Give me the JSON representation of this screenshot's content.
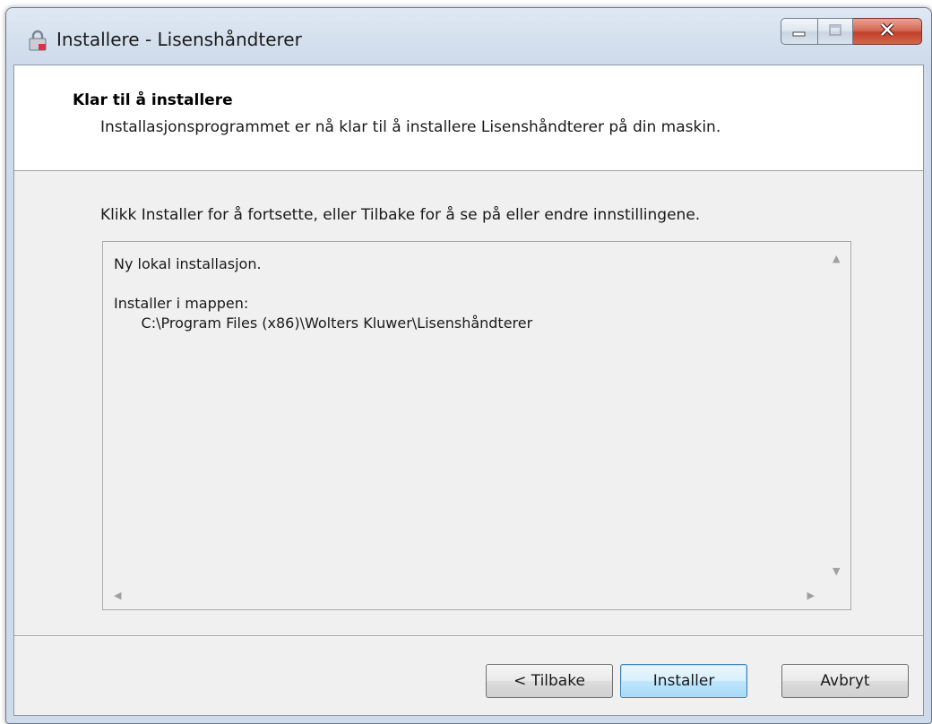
{
  "window": {
    "title": "Installere - Lisenshåndterer",
    "icon": "lock-icon",
    "controls": {
      "minimize": "minimize-icon",
      "maximize": "maximize-icon",
      "close": "close-icon"
    }
  },
  "header": {
    "title": "Klar til å installere",
    "subtitle": "Installasjonsprogrammet er nå klar til å installere Lisenshåndterer på din maskin."
  },
  "main": {
    "instruction": "Klikk Installer for å fortsette, eller Tilbake for å se på eller endre innstillingene.",
    "memo": {
      "line1": "Ny lokal installasjon.",
      "line2": "Installer i mappen:",
      "line3": "      C:\\Program Files (x86)\\Wolters Kluwer\\Lisenshåndterer"
    }
  },
  "buttons": {
    "back": "< Tilbake",
    "install": "Installer",
    "cancel": "Avbryt"
  }
}
